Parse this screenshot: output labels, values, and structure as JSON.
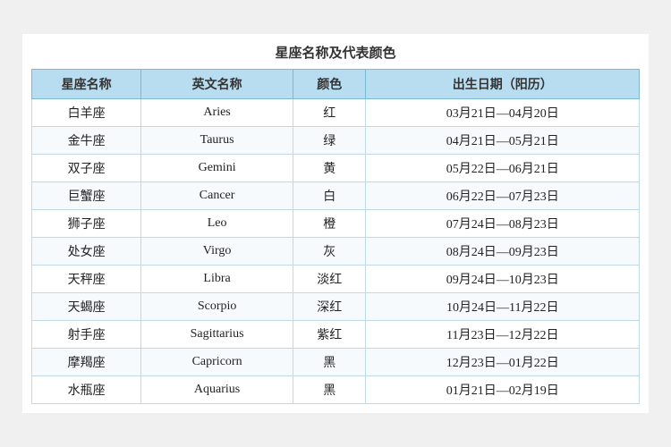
{
  "title": "星座名称及代表颜色",
  "headers": {
    "col1": "星座名称",
    "col2": "英文名称",
    "col3": "颜色",
    "col4": "出生日期（阳历）"
  },
  "rows": [
    {
      "chinese": "白羊座",
      "english": "Aries",
      "color": "红",
      "date": "03月21日—04月20日"
    },
    {
      "chinese": "金牛座",
      "english": "Taurus",
      "color": "绿",
      "date": "04月21日—05月21日"
    },
    {
      "chinese": "双子座",
      "english": "Gemini",
      "color": "黄",
      "date": "05月22日—06月21日"
    },
    {
      "chinese": "巨蟹座",
      "english": "Cancer",
      "color": "白",
      "date": "06月22日—07月23日"
    },
    {
      "chinese": "狮子座",
      "english": "Leo",
      "color": "橙",
      "date": "07月24日—08月23日"
    },
    {
      "chinese": "处女座",
      "english": "Virgo",
      "color": "灰",
      "date": "08月24日—09月23日"
    },
    {
      "chinese": "天秤座",
      "english": "Libra",
      "color": "淡红",
      "date": "09月24日—10月23日"
    },
    {
      "chinese": "天蝎座",
      "english": "Scorpio",
      "color": "深红",
      "date": "10月24日—11月22日"
    },
    {
      "chinese": "射手座",
      "english": "Sagittarius",
      "color": "紫红",
      "date": "11月23日—12月22日"
    },
    {
      "chinese": "摩羯座",
      "english": "Capricorn",
      "color": "黑",
      "date": "12月23日—01月22日"
    },
    {
      "chinese": "水瓶座",
      "english": "Aquarius",
      "color": "黑",
      "date": "01月21日—02月19日"
    }
  ]
}
